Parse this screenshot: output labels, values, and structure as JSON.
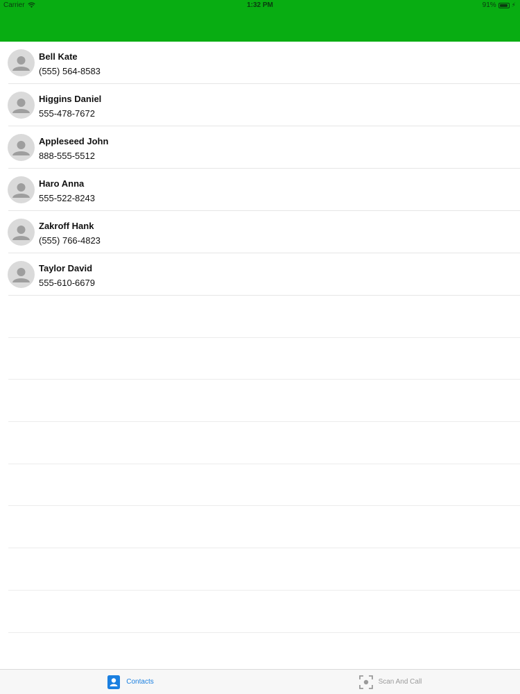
{
  "status_bar": {
    "carrier": "Carrier",
    "time": "1:32 PM",
    "battery": "91%",
    "icons": {
      "wifi": "wifi-icon",
      "battery": "battery-icon",
      "charging": "charging-bolt-icon"
    }
  },
  "theme": {
    "nav_color": "#08ad12",
    "active_tab_color": "#1a7fe0",
    "inactive_tab_color": "#9a9a9a"
  },
  "contacts": [
    {
      "name": "Bell Kate",
      "phone": "(555) 564-8583"
    },
    {
      "name": "Higgins Daniel",
      "phone": "555-478-7672"
    },
    {
      "name": "Appleseed John",
      "phone": "888-555-5512"
    },
    {
      "name": "Haro Anna",
      "phone": "555-522-8243"
    },
    {
      "name": "Zakroff Hank",
      "phone": "(555) 766-4823"
    },
    {
      "name": "Taylor David",
      "phone": "555-610-6679"
    }
  ],
  "tab_bar": {
    "contacts_label": "Contacts",
    "scan_label": "Scan And Call",
    "selected": "Contacts",
    "icons": {
      "contacts": "contacts-icon",
      "scan": "scan-icon"
    }
  }
}
